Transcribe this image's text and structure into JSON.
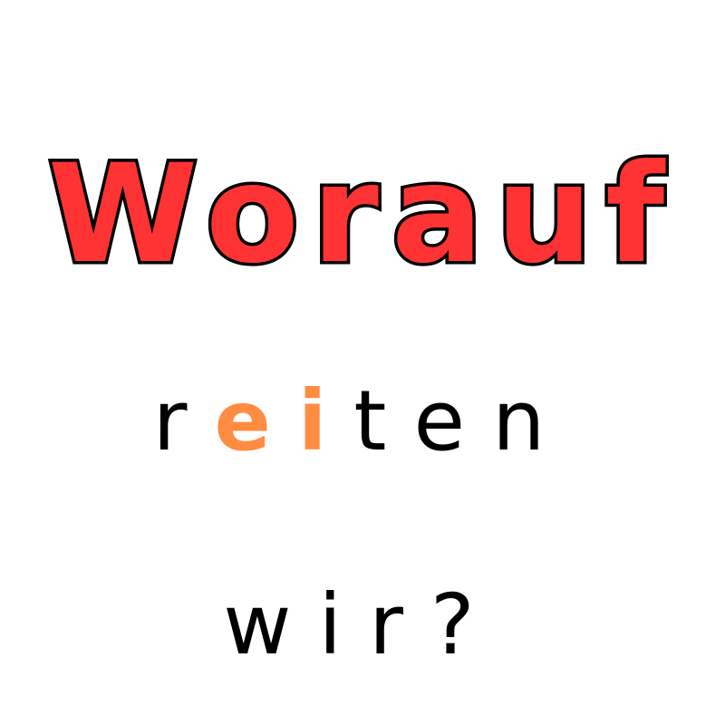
{
  "title": "Worauf",
  "line2": {
    "before": "r",
    "highlight": "ei",
    "after": "ten"
  },
  "line3": "wir?",
  "colors": {
    "title_fill": "#ff3333",
    "title_outline": "#000000",
    "highlight": "#ff8c40",
    "text": "#000000",
    "background": "#ffffff"
  }
}
